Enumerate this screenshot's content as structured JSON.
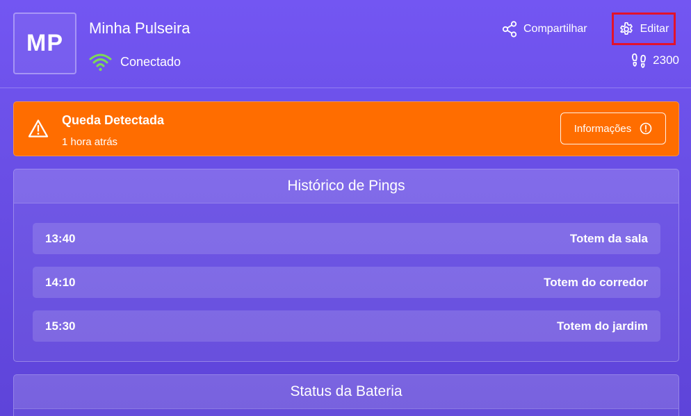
{
  "header": {
    "avatar_initials": "MP",
    "device_name": "Minha Pulseira",
    "connection_status": "Conectado",
    "share_label": "Compartilhar",
    "edit_label": "Editar",
    "steps_count": "2300",
    "icons": {
      "wifi": "wifi-icon",
      "share": "share-icon",
      "edit": "gear-icon",
      "steps": "footprints-icon"
    },
    "colors": {
      "wifi": "#7ed957",
      "edit_highlight": "#e3122a"
    }
  },
  "alert": {
    "title": "Queda Detectada",
    "time": "1 hora atrás",
    "info_label": "Informações",
    "icons": {
      "warning": "warning-icon",
      "info": "info-icon"
    },
    "color": "#ff6d00"
  },
  "pings": {
    "title": "Histórico de Pings",
    "items": [
      {
        "time": "13:40",
        "location": "Totem da sala"
      },
      {
        "time": "14:10",
        "location": "Totem do corredor"
      },
      {
        "time": "15:30",
        "location": "Totem do jardim"
      }
    ]
  },
  "battery": {
    "title": "Status da Bateria"
  }
}
